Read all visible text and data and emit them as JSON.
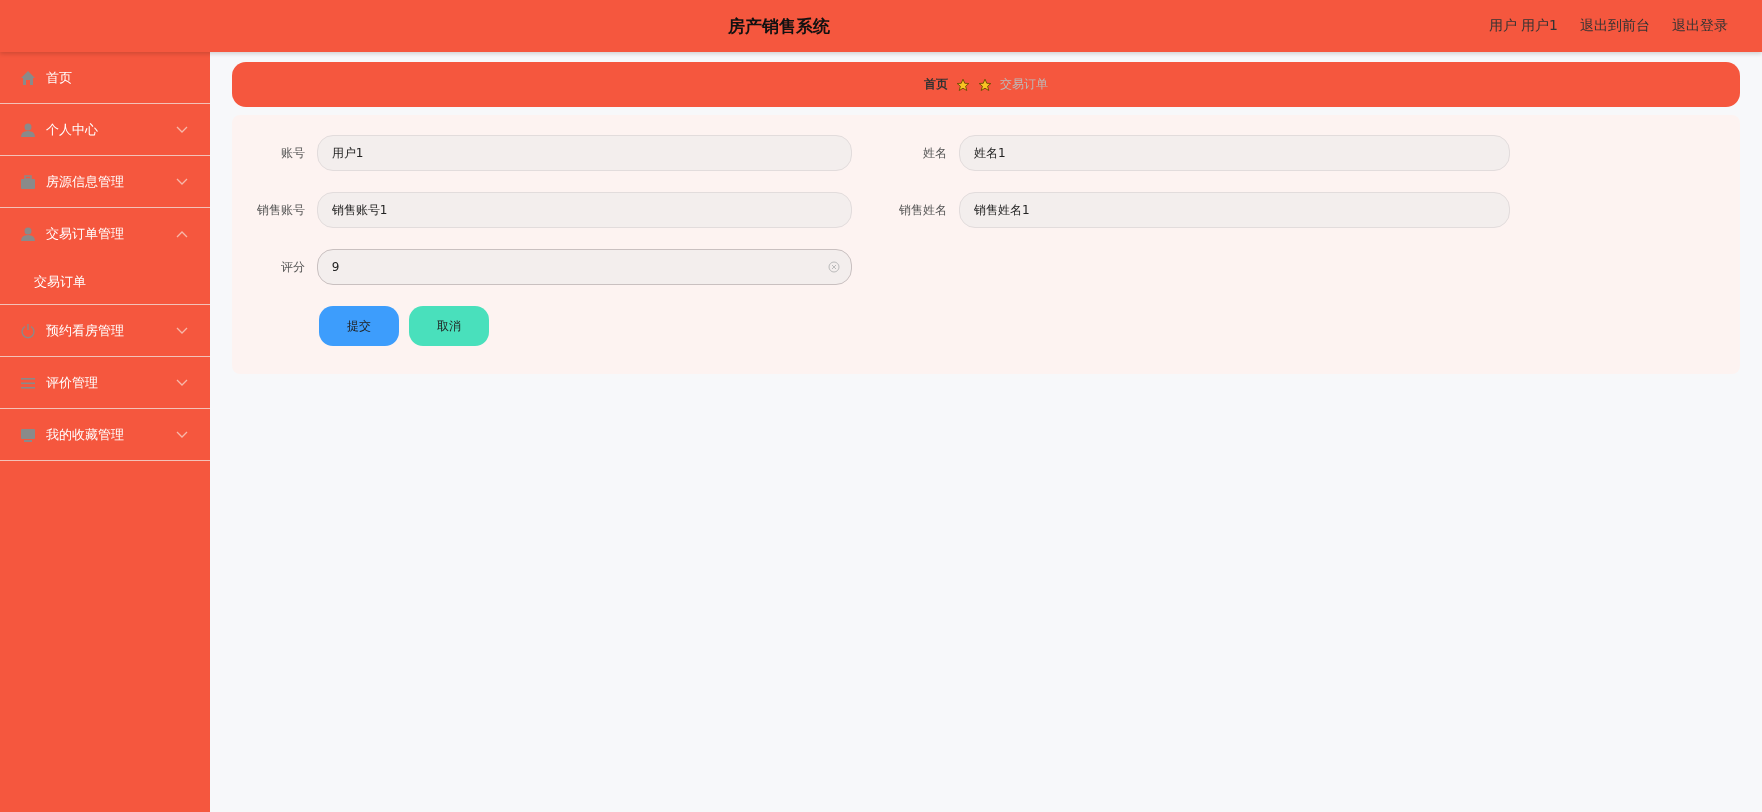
{
  "header": {
    "title": "房产销售系统",
    "user": "用户 用户1",
    "links": [
      "退出到前台",
      "退出登录"
    ]
  },
  "sidebar": {
    "items": [
      {
        "label": "首页"
      },
      {
        "label": "个人中心",
        "expanded": false
      },
      {
        "label": "房源信息管理",
        "expanded": false
      },
      {
        "label": "交易订单管理",
        "expanded": true,
        "children": [
          {
            "label": "交易订单"
          }
        ]
      },
      {
        "label": "预约看房管理",
        "expanded": false
      },
      {
        "label": "评价管理",
        "expanded": false
      },
      {
        "label": "我的收藏管理",
        "expanded": false
      }
    ]
  },
  "breadcrumb": [
    "首页",
    "交易订单"
  ],
  "form": {
    "fields": [
      {
        "label": "账号",
        "value": "用户1",
        "focused": false
      },
      {
        "label": "姓名",
        "value": "姓名1",
        "focused": false
      },
      {
        "label": "销售账号",
        "value": "销售账号1",
        "focused": false
      },
      {
        "label": "销售姓名",
        "value": "销售姓名1",
        "focused": false
      },
      {
        "label": "评分",
        "value": "9",
        "focused": true
      }
    ],
    "buttons": [
      {
        "label": "提交",
        "kind": "primary"
      },
      {
        "label": "取消",
        "kind": "secondary"
      }
    ]
  }
}
